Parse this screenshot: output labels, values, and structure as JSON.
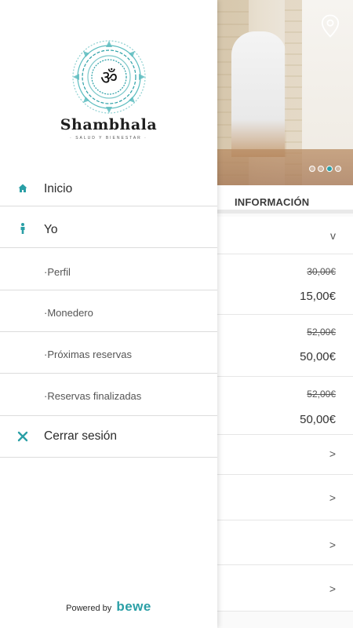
{
  "background": {
    "section_title": "INFORMACIÓN",
    "carousel": {
      "count": 4,
      "active": 3
    },
    "price_items": [
      {
        "old_price": "30,00€",
        "new_price": "15,00€"
      },
      {
        "old_price": "52,00€",
        "new_price": "50,00€"
      },
      {
        "old_price": "52,00€",
        "new_price": "50,00€"
      }
    ],
    "chevron_down": "v",
    "chevron_right": ">"
  },
  "drawer": {
    "brand_name": "Shambhala",
    "brand_tagline": "· SALUD Y BIENESTAR ·",
    "logo_symbol": "ॐ",
    "menu": {
      "inicio": "Inicio",
      "yo": "Yo",
      "perfil": "·Perfil",
      "monedero": "·Monedero",
      "proximas": "·Próximas reservas",
      "finalizadas": "·Reservas finalizadas",
      "cerrar": "Cerrar sesión"
    },
    "footer": {
      "powered_by": "Powered by",
      "brand": "bewe"
    }
  },
  "colors": {
    "accent": "#2a9fa6",
    "text": "#2b2b2b",
    "divider": "#dcdcdc"
  }
}
